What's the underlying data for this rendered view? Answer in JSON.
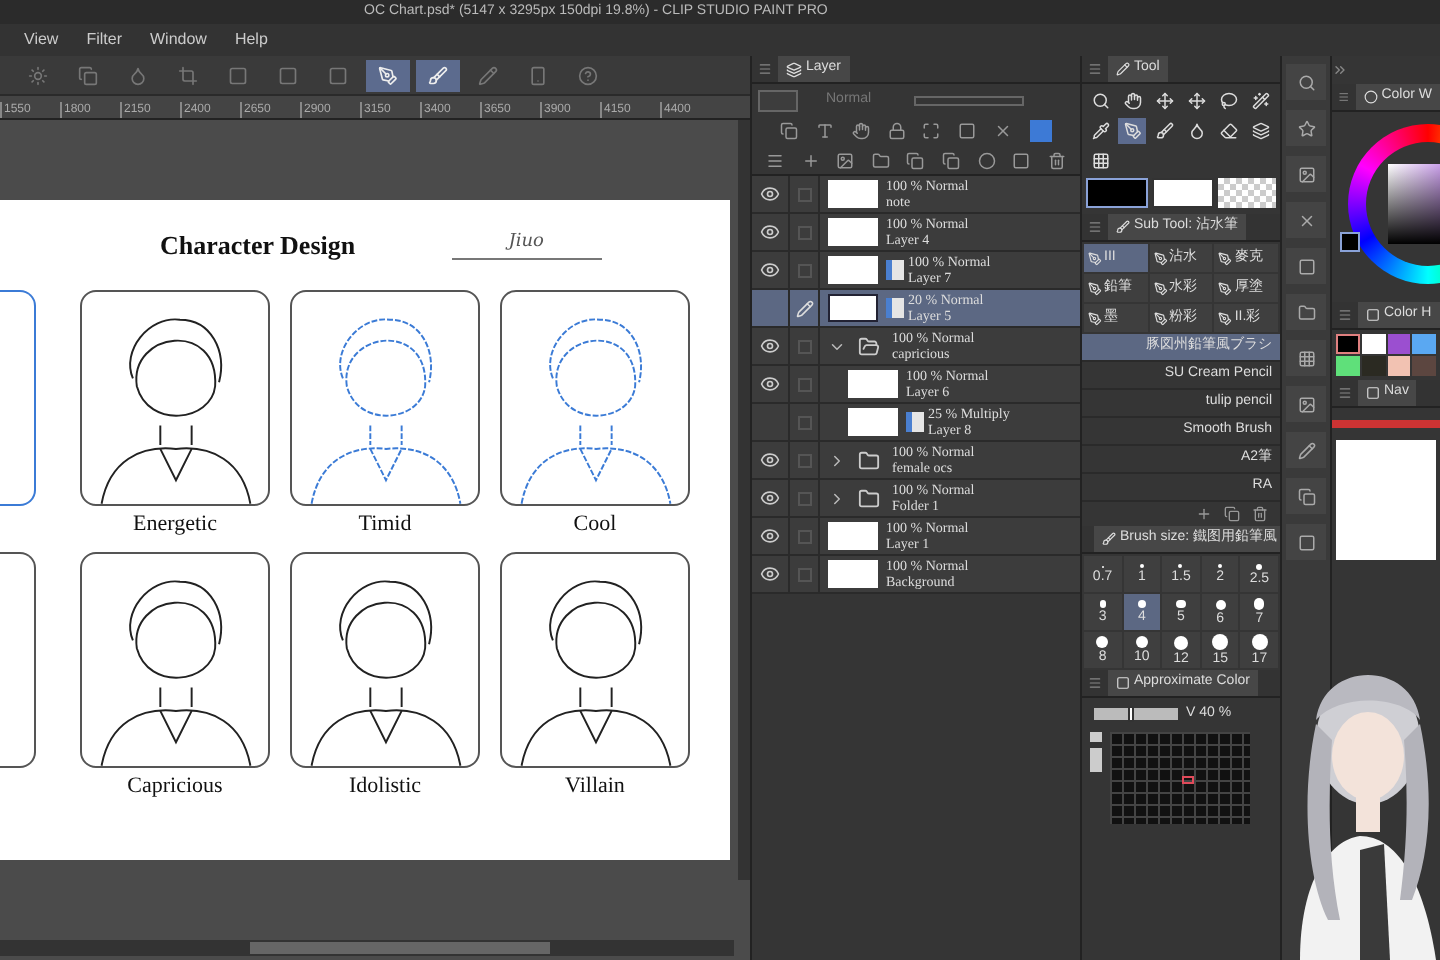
{
  "window": {
    "title": "OC Chart.psd* (5147 x 3295px 150dpi 19.8%)  - CLIP STUDIO PAINT PRO"
  },
  "menu": [
    "View",
    "Filter",
    "Window",
    "Help"
  ],
  "toolbar": [
    {
      "selected": false
    },
    {
      "selected": false
    },
    {
      "selected": false
    },
    {
      "selected": false
    },
    {
      "selected": false
    },
    {
      "selected": false
    },
    {
      "selected": false
    },
    {
      "selected": true
    },
    {
      "selected": true
    },
    {
      "selected": false
    },
    {
      "selected": false
    },
    {
      "selected": false
    }
  ],
  "ruler": [
    "1550",
    "1800",
    "2150",
    "2400",
    "2650",
    "2900",
    "3150",
    "3400",
    "3650",
    "3900",
    "4150",
    "4400"
  ],
  "canvas": {
    "title": "Character Design",
    "signature": "Jiuo",
    "portraits": [
      {
        "label": "Energetic",
        "kind": "lineart",
        "color": "#222222"
      },
      {
        "label": "Timid",
        "kind": "sketch",
        "color": "#3b7bd6"
      },
      {
        "label": "Cool",
        "kind": "sketch",
        "color": "#3b7bd6"
      },
      {
        "label": "Capricious",
        "kind": "lineart",
        "color": "#222222"
      },
      {
        "label": "Idolistic",
        "kind": "lineart",
        "color": "#222222"
      },
      {
        "label": "Villain",
        "kind": "lineart",
        "color": "#222222"
      }
    ]
  },
  "layer_panel": {
    "tab": "Layer",
    "blend": "Normal",
    "opacity": {
      "level": 0
    },
    "layers": [
      {
        "mode": "100 % Normal",
        "name": "note",
        "visible": true,
        "selected": false,
        "kind": "layer",
        "badge": false
      },
      {
        "mode": "100 % Normal",
        "name": "Layer 4",
        "visible": true,
        "selected": false,
        "kind": "layer",
        "badge": false
      },
      {
        "mode": "100 % Normal",
        "name": "Layer 7",
        "visible": true,
        "selected": false,
        "kind": "layer",
        "badge": true
      },
      {
        "mode": "20 % Normal",
        "name": "Layer 5",
        "visible": false,
        "selected": true,
        "kind": "layer",
        "badge": true
      },
      {
        "mode": "100 % Normal",
        "name": "capricious",
        "visible": true,
        "selected": false,
        "kind": "folder",
        "expanded": true,
        "children": [
          {
            "mode": "100 % Normal",
            "name": "Layer 6",
            "visible": true,
            "selected": false,
            "kind": "layer",
            "badge": false
          },
          {
            "mode": "25 % Multiply",
            "name": "Layer 8",
            "visible": false,
            "selected": false,
            "kind": "layer",
            "badge": true
          }
        ]
      },
      {
        "mode": "100 % Normal",
        "name": "female ocs",
        "visible": true,
        "selected": false,
        "kind": "folder",
        "expanded": false
      },
      {
        "mode": "100 % Normal",
        "name": "Folder 1",
        "visible": true,
        "selected": false,
        "kind": "folder",
        "expanded": false
      },
      {
        "mode": "100 % Normal",
        "name": "Layer 1",
        "visible": true,
        "selected": false,
        "kind": "layer",
        "badge": false
      },
      {
        "mode": "100 % Normal",
        "name": "Background",
        "visible": true,
        "selected": false,
        "kind": "layer",
        "badge": false
      }
    ]
  },
  "tool_panel": {
    "tab": "Tool",
    "tools": [
      {
        "selected": false
      },
      {
        "selected": false
      },
      {
        "selected": false
      },
      {
        "selected": false
      },
      {
        "selected": false
      },
      {
        "selected": false
      },
      {
        "selected": false
      },
      {
        "selected": true
      },
      {
        "selected": false
      },
      {
        "selected": false
      },
      {
        "selected": false
      },
      {
        "selected": false
      },
      {
        "selected": false
      }
    ],
    "colors": [
      {
        "kind": "main",
        "color": "#000000",
        "selected": true
      },
      {
        "kind": "sub",
        "color": "#ffffff",
        "selected": false
      },
      {
        "kind": "transparent",
        "selected": false
      }
    ]
  },
  "sub_tool": {
    "tab": "Sub Tool: 沾水筆",
    "groups": [
      {
        "label": "III",
        "selected": true
      },
      {
        "label": "沾水",
        "selected": false
      },
      {
        "label": "麥克",
        "selected": false
      },
      {
        "label": "鉛筆",
        "selected": false
      },
      {
        "label": "水彩",
        "selected": false
      },
      {
        "label": "厚塗",
        "selected": false
      },
      {
        "label": "墨",
        "selected": false
      },
      {
        "label": "粉彩",
        "selected": false
      },
      {
        "label": "II.彩",
        "selected": false
      }
    ],
    "brushes": [
      {
        "name": "豚図州鉛筆風ブラシ",
        "selected": true
      },
      {
        "name": "SU Cream Pencil",
        "selected": false
      },
      {
        "name": "tulip pencil",
        "selected": false
      },
      {
        "name": "Smooth Brush",
        "selected": false
      },
      {
        "name": "A2筆",
        "selected": false
      },
      {
        "name": "RA",
        "selected": false
      }
    ]
  },
  "brush_size": {
    "tab": "Brush size: 鐵图用鉛筆風",
    "sizes": [
      {
        "label": "0.7",
        "selected": false
      },
      {
        "label": "1",
        "selected": false
      },
      {
        "label": "1.5",
        "selected": false
      },
      {
        "label": "2",
        "selected": false
      },
      {
        "label": "2.5",
        "selected": false
      },
      {
        "label": "3",
        "selected": false
      },
      {
        "label": "4",
        "selected": true
      },
      {
        "label": "5",
        "selected": false
      },
      {
        "label": "6",
        "selected": false
      },
      {
        "label": "7",
        "selected": false
      },
      {
        "label": "8",
        "selected": false
      },
      {
        "label": "10",
        "selected": false
      },
      {
        "label": "12",
        "selected": false
      },
      {
        "label": "15",
        "selected": false
      },
      {
        "label": "17",
        "selected": false
      }
    ]
  },
  "approximate_color": {
    "tab": "Approximate Color",
    "reading": "V  40 %",
    "level": 0.4,
    "side_slider": {
      "level": 0.7
    }
  },
  "color_panel": {
    "wheel_tab": "Color W",
    "history_tab": "Color H",
    "nav_tab": "Nav",
    "swatches": [
      {
        "color": "#000000",
        "selected": true
      },
      {
        "color": "#ffffff",
        "selected": false
      },
      {
        "color": "#9b4fd0",
        "selected": false
      },
      {
        "color": "#5aa8f2",
        "selected": false
      },
      {
        "color": "#5fe07a",
        "selected": false
      },
      {
        "color": "#2b2a22",
        "selected": false
      },
      {
        "color": "#f2c2b2",
        "selected": false
      },
      {
        "color": "#5c4640",
        "selected": false
      }
    ]
  },
  "avatar": {
    "kind": "picture"
  }
}
